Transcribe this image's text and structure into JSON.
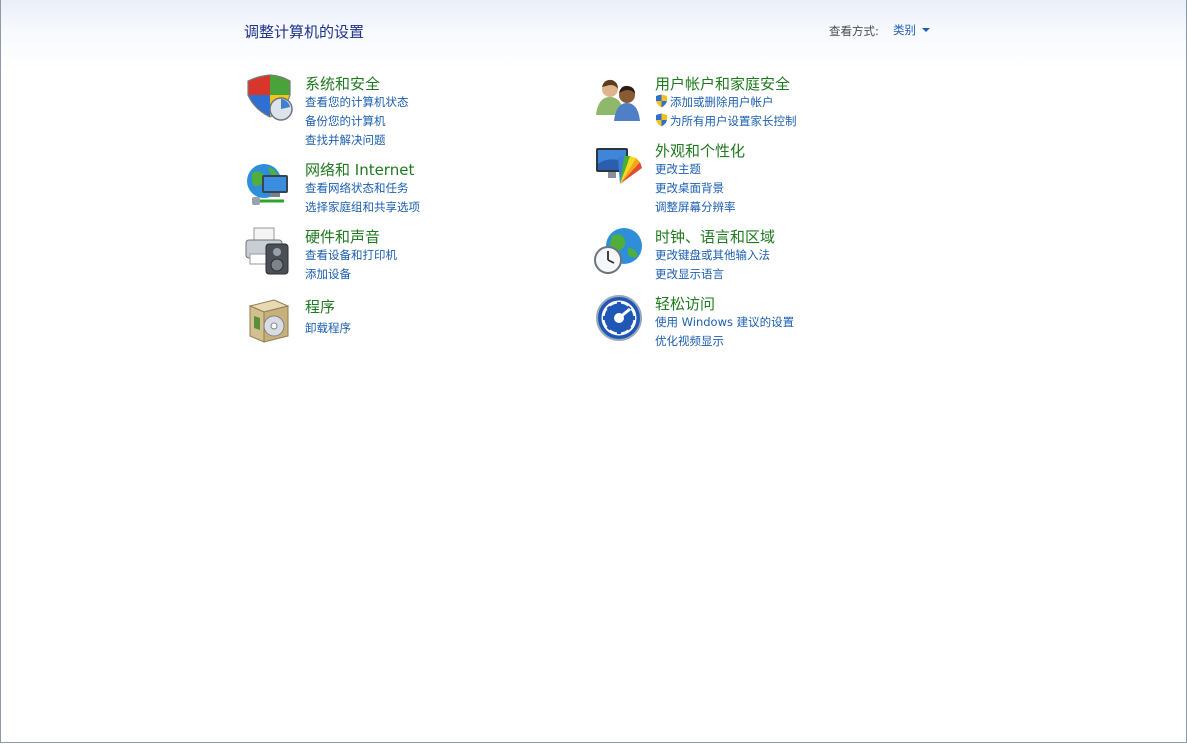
{
  "header": {
    "title": "调整计算机的设置",
    "view_by_label": "查看方式:",
    "view_by_value": "类别"
  },
  "categories": [
    {
      "title": "系统和安全",
      "icon": "security-shield-icon",
      "links": [
        "查看您的计算机状态",
        "备份您的计算机",
        "查找并解决问题"
      ]
    },
    {
      "title": "网络和 Internet",
      "icon": "network-globe-icon",
      "links": [
        "查看网络状态和任务",
        "选择家庭组和共享选项"
      ]
    },
    {
      "title": "硬件和声音",
      "icon": "printer-speaker-icon",
      "links": [
        "查看设备和打印机",
        "添加设备"
      ]
    },
    {
      "title": "程序",
      "icon": "programs-box-icon",
      "links": [
        "卸载程序"
      ]
    },
    {
      "title": "用户帐户和家庭安全",
      "icon": "users-icon",
      "links": [
        "添加或删除用户帐户",
        "为所有用户设置家长控制"
      ],
      "link_icons": [
        "uac-shield-icon",
        "uac-shield-icon"
      ]
    },
    {
      "title": "外观和个性化",
      "icon": "display-palette-icon",
      "links": [
        "更改主题",
        "更改桌面背景",
        "调整屏幕分辨率"
      ]
    },
    {
      "title": "时钟、语言和区域",
      "icon": "clock-globe-icon",
      "links": [
        "更改键盘或其他输入法",
        "更改显示语言"
      ]
    },
    {
      "title": "轻松访问",
      "icon": "ease-of-access-icon",
      "links": [
        "使用 Windows 建议的设置",
        "优化视频显示"
      ]
    }
  ]
}
